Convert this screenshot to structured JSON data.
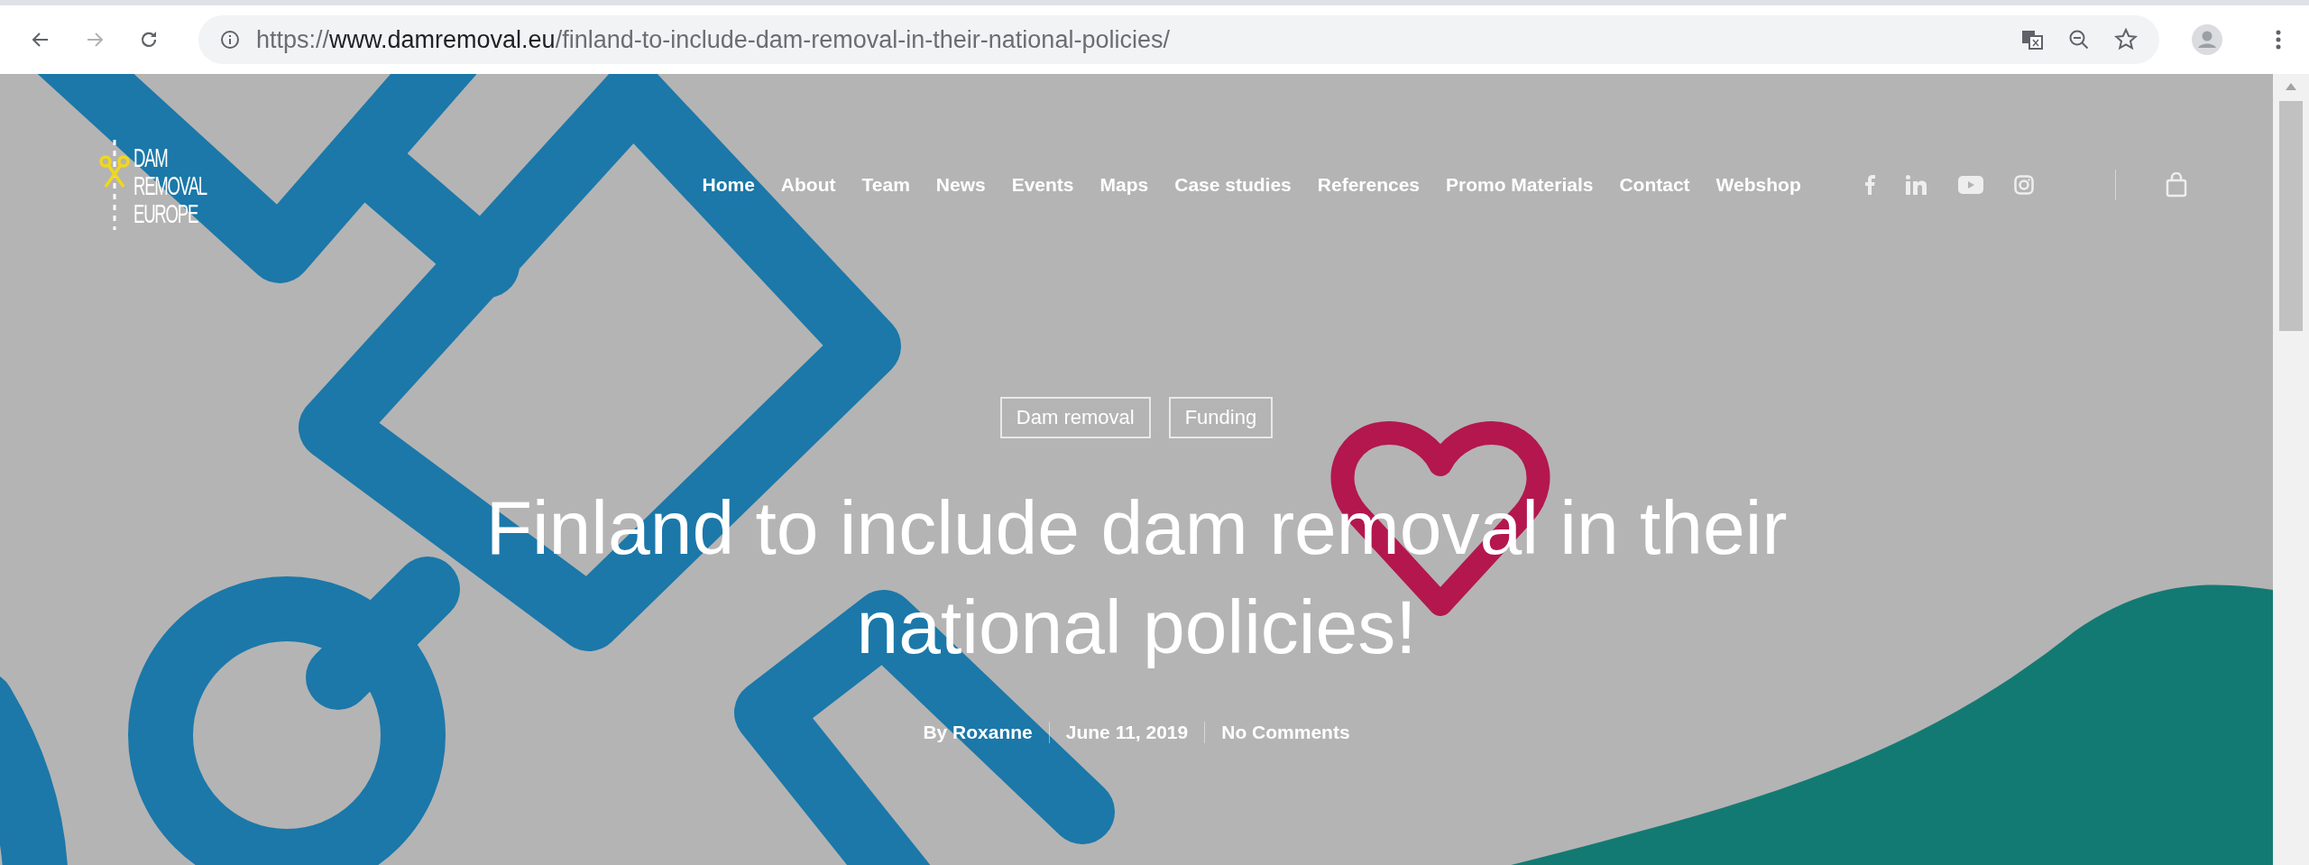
{
  "browser": {
    "url_scheme": "https://",
    "url_host": "www.damremoval.eu",
    "url_path": "/finland-to-include-dam-removal-in-their-national-policies/"
  },
  "logo": {
    "lines": [
      "DAM",
      "REMOVAL",
      "EUROPE"
    ]
  },
  "nav": [
    "Home",
    "About",
    "Team",
    "News",
    "Events",
    "Maps",
    "Case studies",
    "References",
    "Promo Materials",
    "Contact",
    "Webshop"
  ],
  "tags": [
    "Dam removal",
    "Funding"
  ],
  "title": "Finland to include dam removal in their national policies!",
  "meta": {
    "author": "By Roxanne",
    "date": "June 11, 2019",
    "comments": "No Comments"
  }
}
